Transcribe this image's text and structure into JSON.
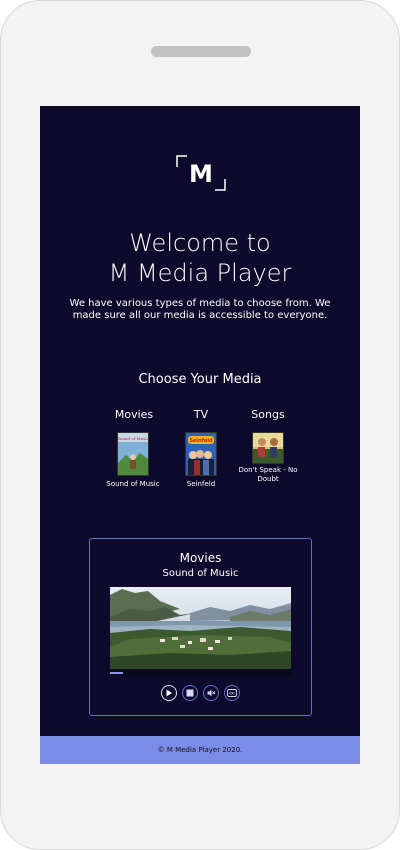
{
  "app": {
    "title_line1": "Welcome to",
    "title_line2": "M Media Player",
    "intro": "We have various types of media to choose from. We made sure all our media is accessible to everyone.",
    "logo_letter": "M"
  },
  "chooser": {
    "heading": "Choose Your Media",
    "categories": [
      {
        "label": "Movies",
        "item": "Sound of Music"
      },
      {
        "label": "TV",
        "item": "Seinfeld"
      },
      {
        "label": "Songs",
        "item": "Don't Speak - No Doubt"
      }
    ]
  },
  "player": {
    "category": "Movies",
    "title": "Sound of Music",
    "progress": 0.07,
    "controls": [
      {
        "name": "play-icon"
      },
      {
        "name": "stop-icon"
      },
      {
        "name": "mute-icon"
      },
      {
        "name": "captions-icon"
      }
    ],
    "captions_glyph": "CC"
  },
  "footer": {
    "copyright": "© M Media Player 2020."
  },
  "colors": {
    "background": "#0d0a2b",
    "accent": "#7a8be8",
    "player_border": "#5d6fc6"
  }
}
